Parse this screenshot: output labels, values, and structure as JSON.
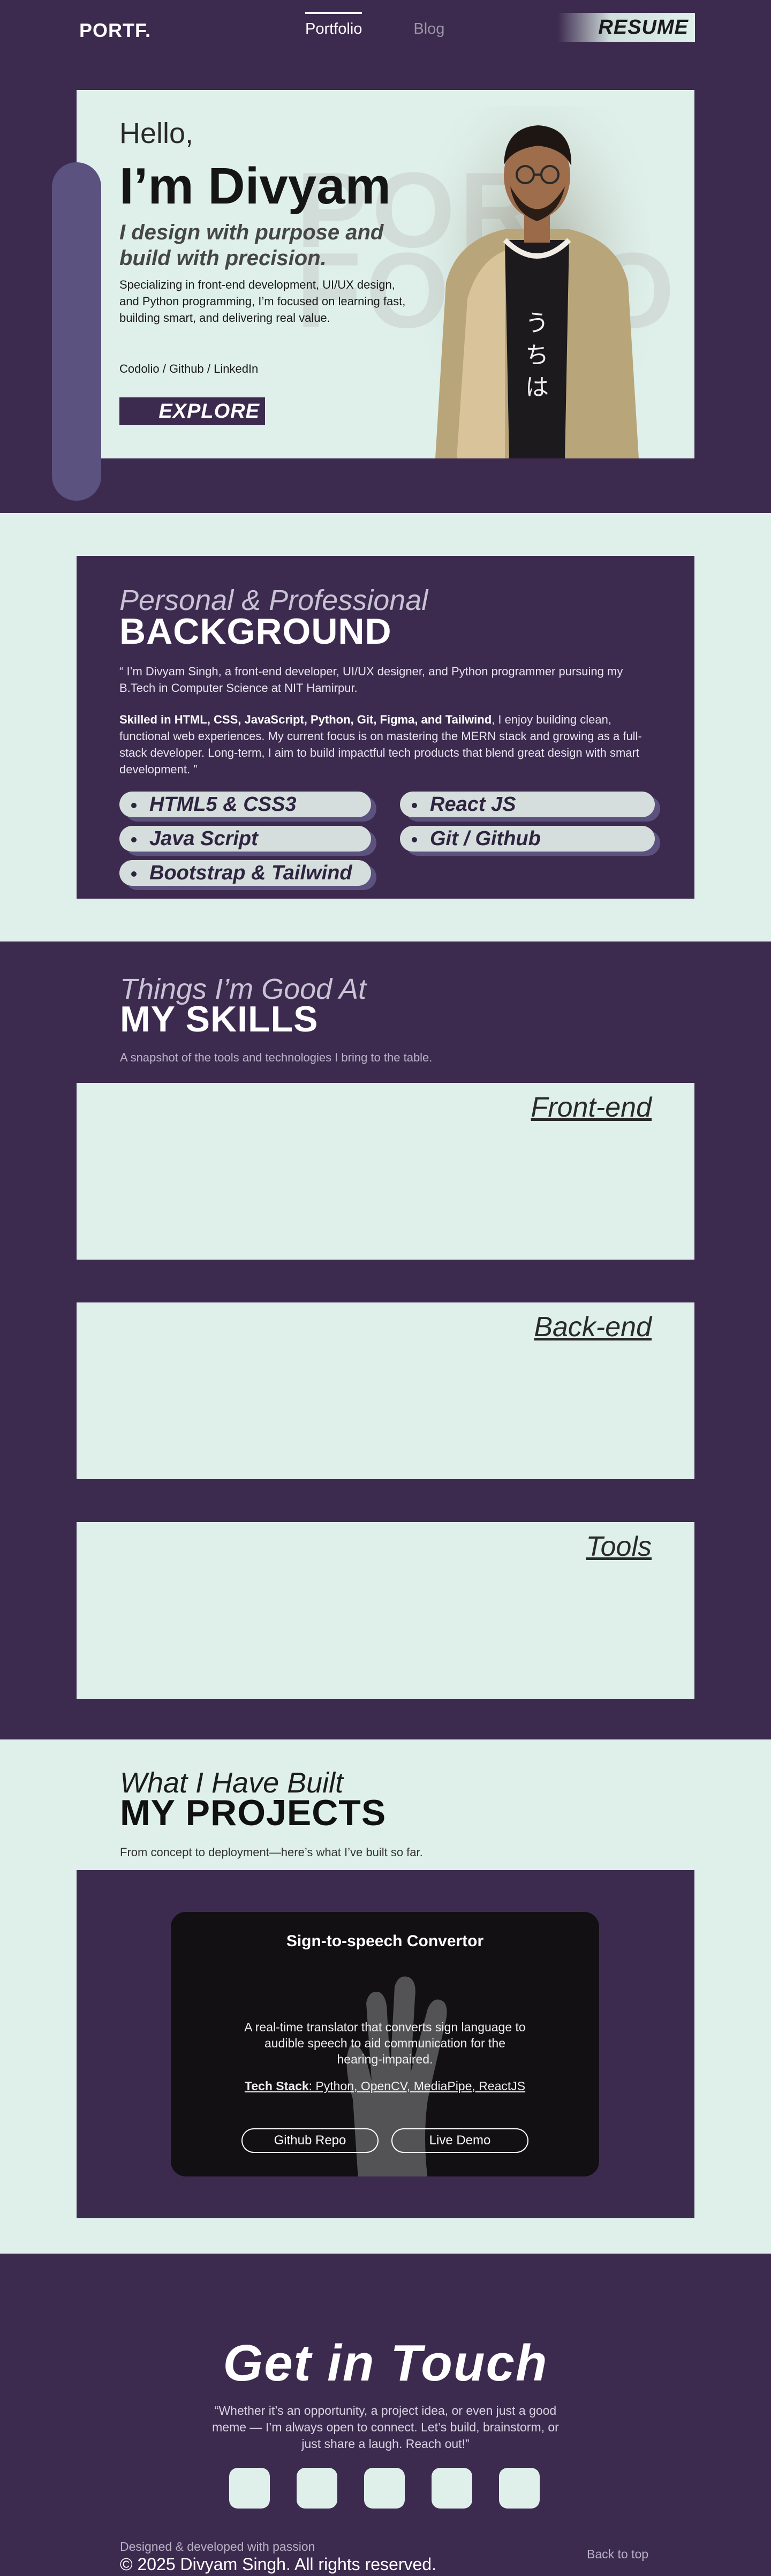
{
  "header": {
    "logo": "PORTF.",
    "nav": [
      {
        "label": "Portfolio"
      },
      {
        "label": "Blog"
      }
    ],
    "resume": "RESUME"
  },
  "hero": {
    "hello": "Hello,",
    "name": "I’m Divyam",
    "tagline": "I design with purpose and build with precision.",
    "description": "Specializing in front-end development, UI/UX design, and Python programming, I’m focused on learning fast, building smart, and delivering real value.",
    "links": "Codolio / Github / LinkedIn",
    "explore": "EXPLORE",
    "watermark": "POR FO LIO"
  },
  "background": {
    "kicker": "Personal & Professional",
    "title": "BACKGROUND",
    "para1": "“ I’m Divyam Singh, a front-end developer, UI/UX designer, and Python programmer pursuing my B.Tech in Computer Science at NIT Hamirpur.",
    "para2_bold": "Skilled in HTML, CSS, JavaScript, Python, Git, Figma, and Tailwind",
    "para2_rest": ", I enjoy building clean, functional web experiences. My current focus is on mastering the MERN stack and growing as a full-stack developer. Long-term, I aim to build impactful tech products that blend great design with smart development. ”",
    "chips": [
      "HTML5 & CSS3",
      "React JS",
      "Java Script",
      "Git / Github",
      "Bootstrap & Tailwind"
    ]
  },
  "skills": {
    "kicker": "Things I’m Good At",
    "title": "MY SKILLS",
    "subtitle": "A snapshot of the tools and technologies I bring to the table.",
    "boxes": [
      "Front-end",
      "Back-end",
      "Tools"
    ]
  },
  "projects": {
    "kicker": "What I Have Built",
    "title": "MY PROJECTS",
    "subtitle": "From concept to deployment—here’s what I’ve built so far.",
    "card": {
      "title": "Sign-to-speech Convertor",
      "description": "A real-time translator that converts sign language to audible speech to aid communication for the hearing-impaired.",
      "stack_label": "Tech Stack",
      "stack": ": Python, OpenCV, MediaPipe, ReactJS",
      "github": "Github Repo",
      "demo": "Live Demo"
    }
  },
  "contact": {
    "title": "Get in Touch",
    "description": "“Whether it’s an opportunity, a project idea, or even just a good meme — I’m always open to connect. Let’s build, brainstorm, or just share a laugh. Reach out!”",
    "made": "Designed & developed with passion",
    "copyright": "© 2025 Divyam Singh. All rights reserved.",
    "back_to_top": "Back to top"
  }
}
